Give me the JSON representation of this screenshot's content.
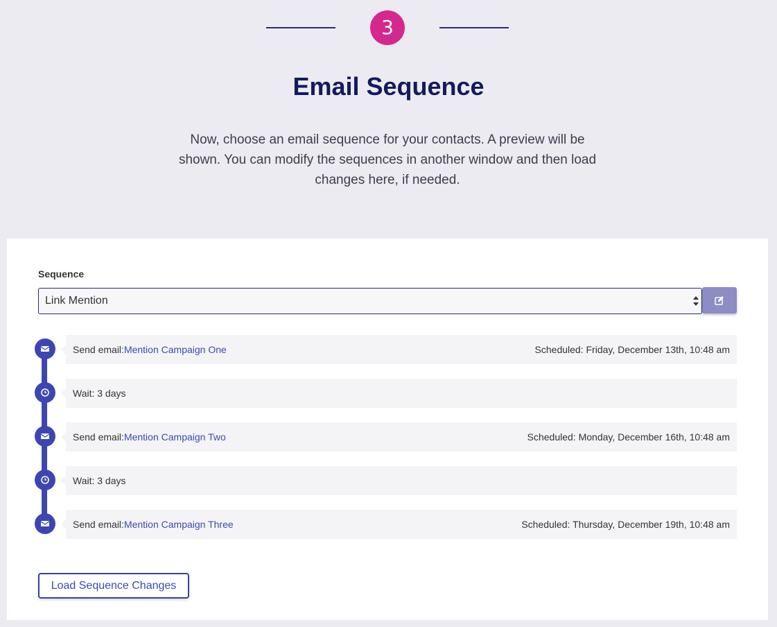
{
  "step": {
    "number": "3",
    "title": "Email Sequence",
    "description": "Now, choose an email sequence for your contacts. A preview will be shown. You can modify the sequences in another window and then load changes here, if needed."
  },
  "form": {
    "sequence_label": "Sequence",
    "sequence_value": "Link Mention",
    "edit_icon": "edit-icon"
  },
  "timeline": {
    "items": [
      {
        "type": "email",
        "icon": "envelope-icon",
        "prefix": "Send email:",
        "link": "Mention Campaign One",
        "scheduled": "Scheduled: Friday, December 13th, 10:48 am"
      },
      {
        "type": "wait",
        "icon": "clock-icon",
        "text": "Wait: 3 days"
      },
      {
        "type": "email",
        "icon": "envelope-icon",
        "prefix": "Send email:",
        "link": "Mention Campaign Two",
        "scheduled": "Scheduled: Monday, December 16th, 10:48 am"
      },
      {
        "type": "wait",
        "icon": "clock-icon",
        "text": "Wait: 3 days"
      },
      {
        "type": "email",
        "icon": "envelope-icon",
        "prefix": "Send email:",
        "link": "Mention Campaign Three",
        "scheduled": "Scheduled: Thursday, December 19th, 10:48 am"
      }
    ]
  },
  "actions": {
    "load_label": "Load Sequence Changes"
  },
  "colors": {
    "accent": "#d4288f",
    "title": "#141a5e",
    "timeline": "#3d46b0",
    "link": "#3a4ab2",
    "edit_button": "#8c8dc4"
  }
}
